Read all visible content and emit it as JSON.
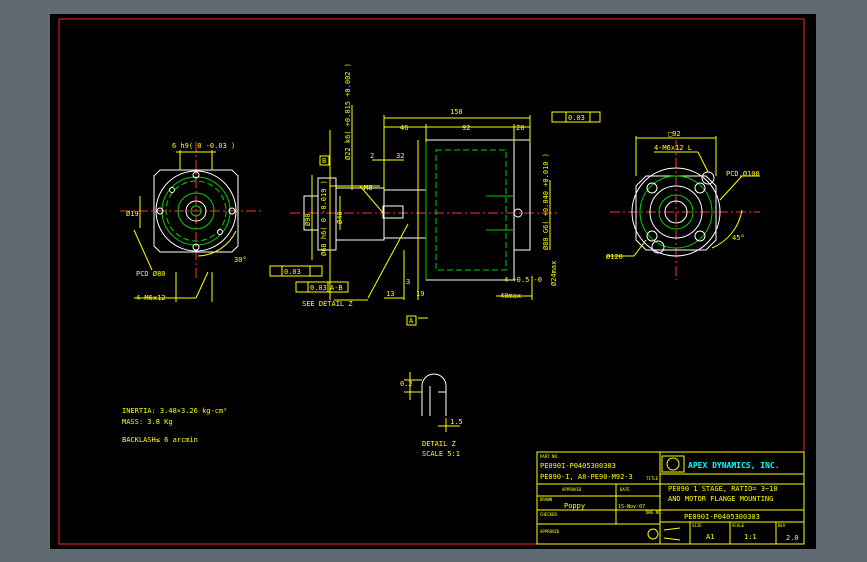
{
  "notes": {
    "inertia": "INERTIA: 3.48×3.26 kg-cm²",
    "mass": "MASS: 3.8 Kg",
    "backlash": "BACKLASH≤ 6 arcmin"
  },
  "detail": {
    "title": "DETAIL Z",
    "scale": "SCALE 5:1",
    "dim_a": "0.2",
    "dim_b": "1.5"
  },
  "views": {
    "left": {
      "top_label": "6 h9( 0 -0.03 )",
      "pcd": "PCD Ø80",
      "holes": "4-M6x12",
      "angle": "30°",
      "shaft_dim": "Ø19"
    },
    "side": {
      "overall": "158",
      "dim_46": "46",
      "dim_92": "92",
      "dim_20": "20",
      "dim_2": "2",
      "dim_32": "32",
      "dim_m8": "M8",
      "dim_3": "3",
      "dim_13": "13",
      "dim_19": "19",
      "dim_ref_B": "B",
      "dim_ref_A": "A",
      "tol_parallel": "0.03",
      "tol_perp_a": "0.03",
      "tol_perp_ab": "0.03",
      "tol_perp_ab_ref": "A-B",
      "shaft_dia_1": "Ø22 k6( +0.015 +0.002 )",
      "shaft_dia_2": "Ø68 h6( 0 -0.019 )",
      "dia_40": "Ø40",
      "dia_90": "Ø90",
      "motor_bore": "Ø80 G6( +0.040 +0.010 )",
      "max_24": "Ø24max",
      "dim_4": "4 +0.5 -0",
      "dim_40max": "40max",
      "see_detail": "SEE DETAIL Z"
    },
    "right": {
      "square": "□92",
      "holes": "4-M6x12 L",
      "pcd": "PCD Ø100",
      "dia": "Ø120",
      "angle": "45°"
    }
  },
  "title_block": {
    "part_no_label": "PART NO.",
    "part_no_1": "PE090I-P0405300303",
    "part_no_2": "PE090-I, A8-PE90-M92-3",
    "company": "APEX DYNAMICS, INC.",
    "title_label": "TITLE",
    "title_1": "PE090 1 STAGE, RATIO= 3~10",
    "title_2": "AND MOTOR FLANGE MOUNTING",
    "approved_label": "APPROVED",
    "date_label": "DATE",
    "drawn_label": "DRAWN",
    "drawn_by": "Poppy",
    "date": "15-Nov-07",
    "checked_label": "CHECKED",
    "dwg_no_label": "DWG NO.",
    "dwg_no": "PE090I-P0405300303",
    "size_label": "SIZE",
    "size": "A1",
    "scale_label": "SCALE",
    "scale": "1:1",
    "rev_label": "REV",
    "rev": "2.0",
    "approved2_label": "APPROVED"
  }
}
